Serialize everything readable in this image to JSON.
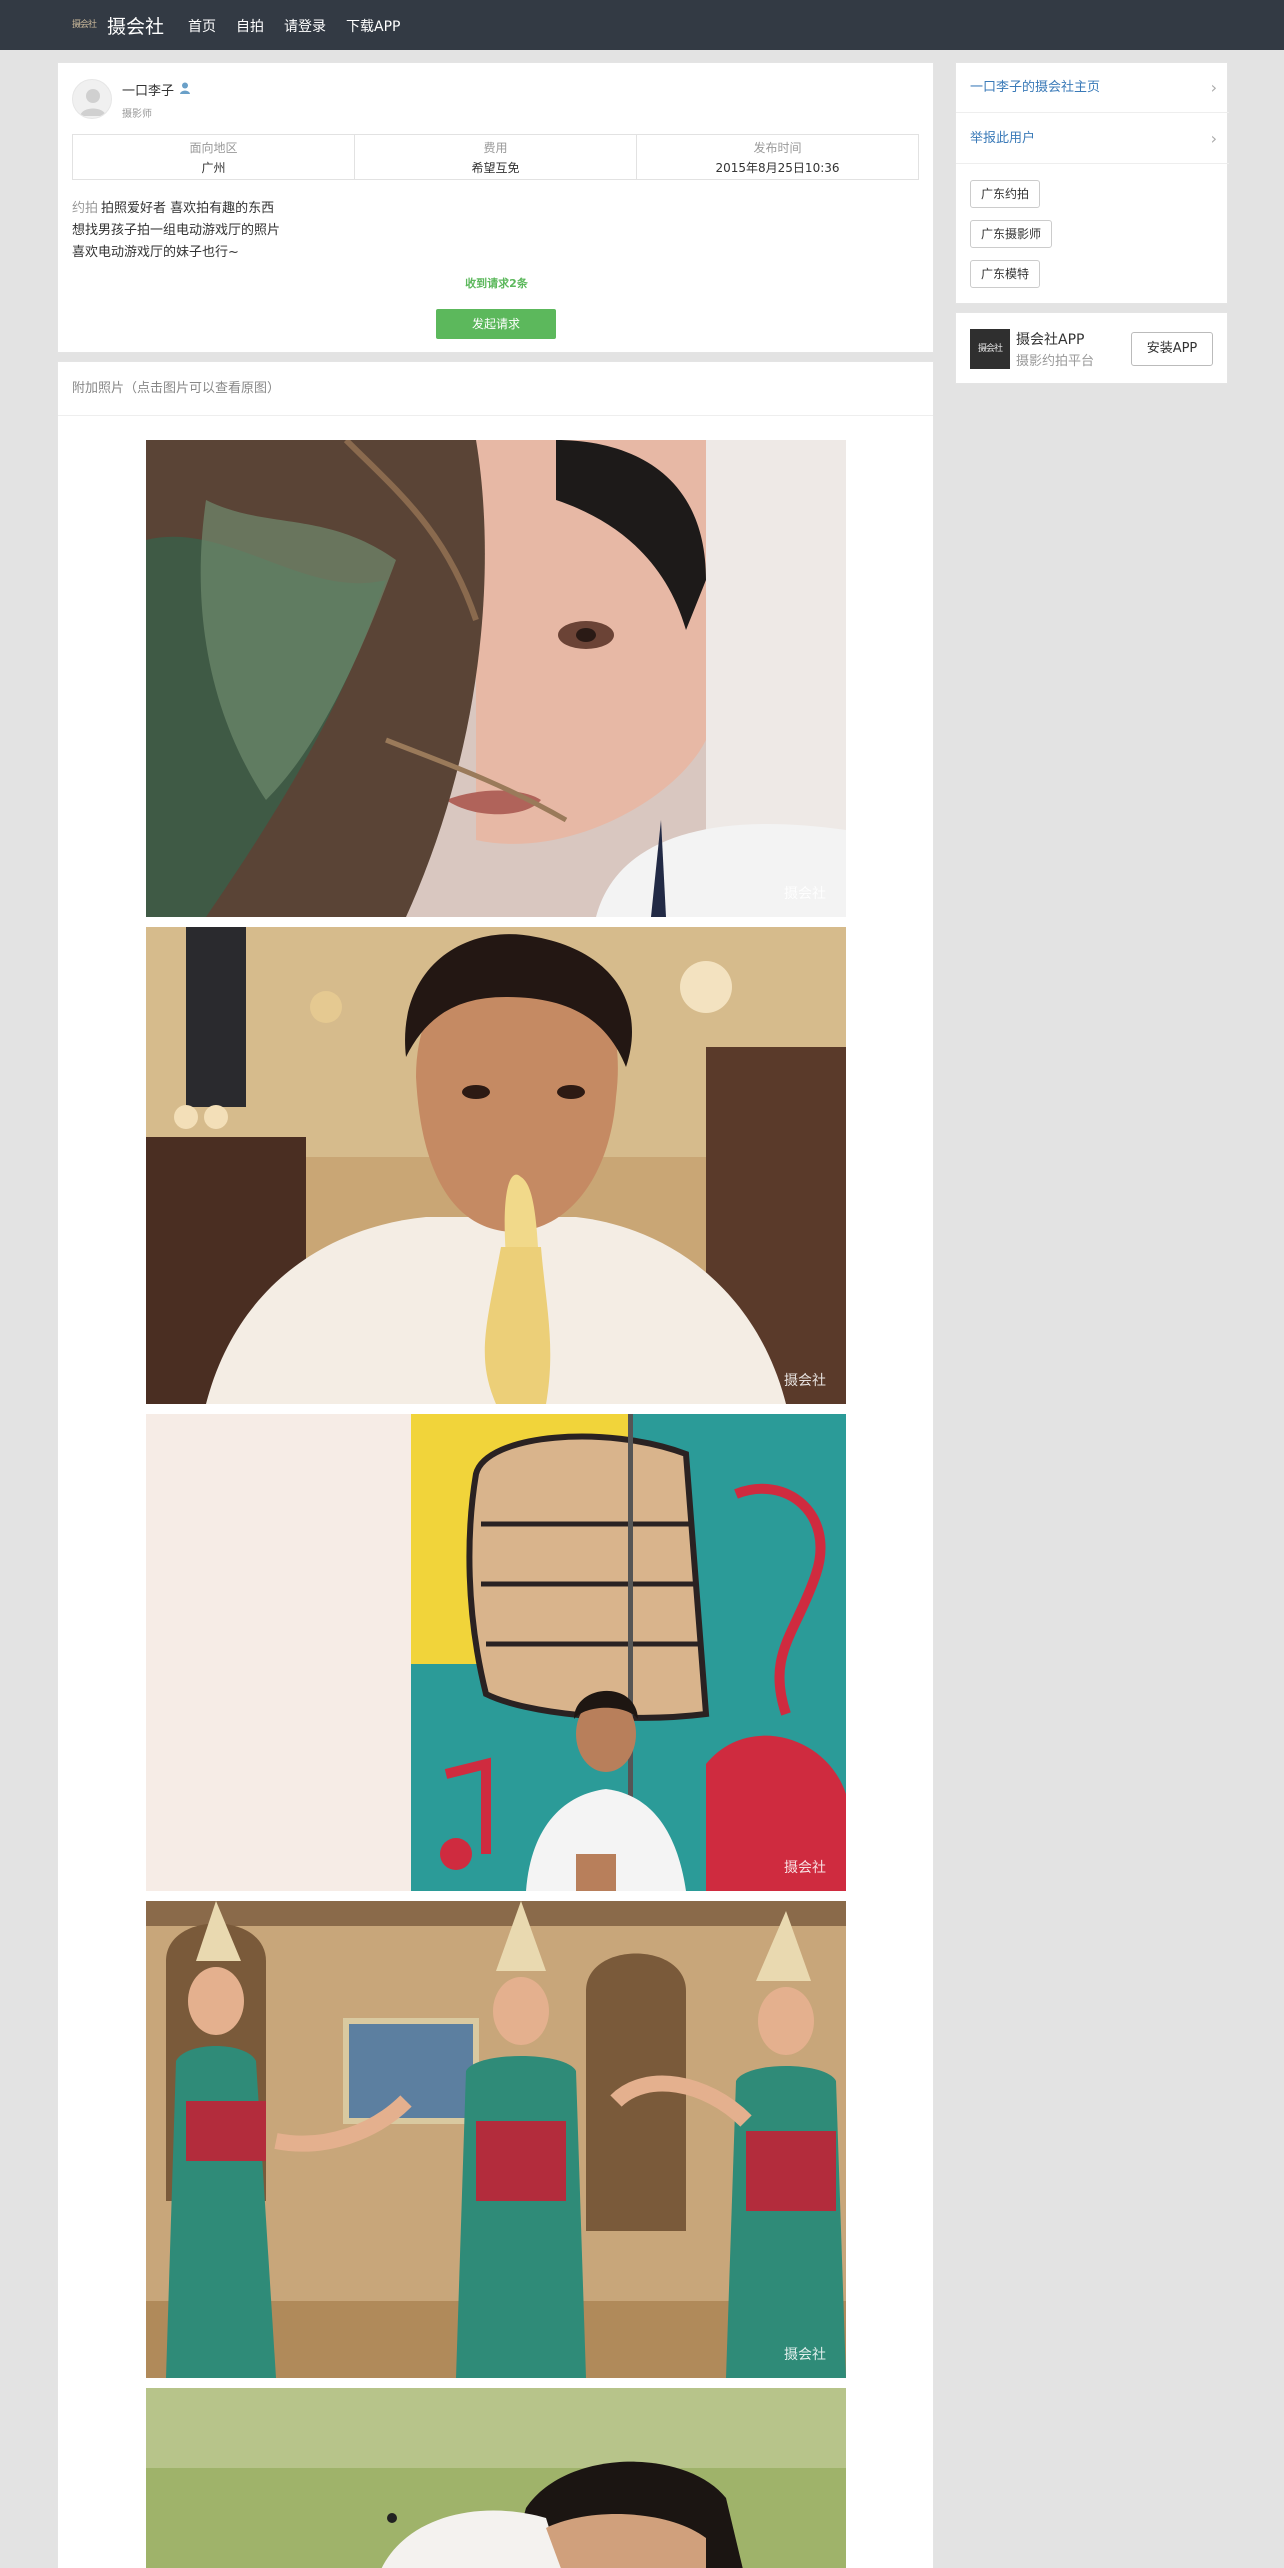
{
  "nav": {
    "logo_mark": "摄会社",
    "logo_text": "摄会社",
    "links": [
      "首页",
      "自拍",
      "请登录",
      "下载APP"
    ]
  },
  "post": {
    "username": "一口李子",
    "role": "摄影师",
    "info": {
      "region_label": "面向地区",
      "region_value": "广州",
      "fee_label": "费用",
      "fee_value": "希望互免",
      "time_label": "发布时间",
      "time_value": "2015年8月25日10:36"
    },
    "desc_tag": "约拍",
    "desc_lines": [
      "拍照爱好者 喜欢拍有趣的东西",
      "想找男孩子拍一组电动游戏厅的照片",
      "喜欢电动游戏厅的妹子也行~"
    ],
    "request_count": "收到请求2条",
    "request_button": "发起请求"
  },
  "photos": {
    "header": "附加照片（点击图片可以查看原图）",
    "watermark": "摄会社"
  },
  "sidebar": {
    "home_link": "一口李子的摄会社主页",
    "report_link": "举报此用户",
    "tags": [
      "广东约拍",
      "广东摄影师",
      "广东模特"
    ],
    "app_logo": "摄会社",
    "app_title": "摄会社APP",
    "app_sub": "摄影约拍平台",
    "install_button": "安装APP"
  },
  "colors": {
    "nav_bg": "#333a44",
    "accent_green": "#5cb85c",
    "link_blue": "#3a7ab8"
  }
}
